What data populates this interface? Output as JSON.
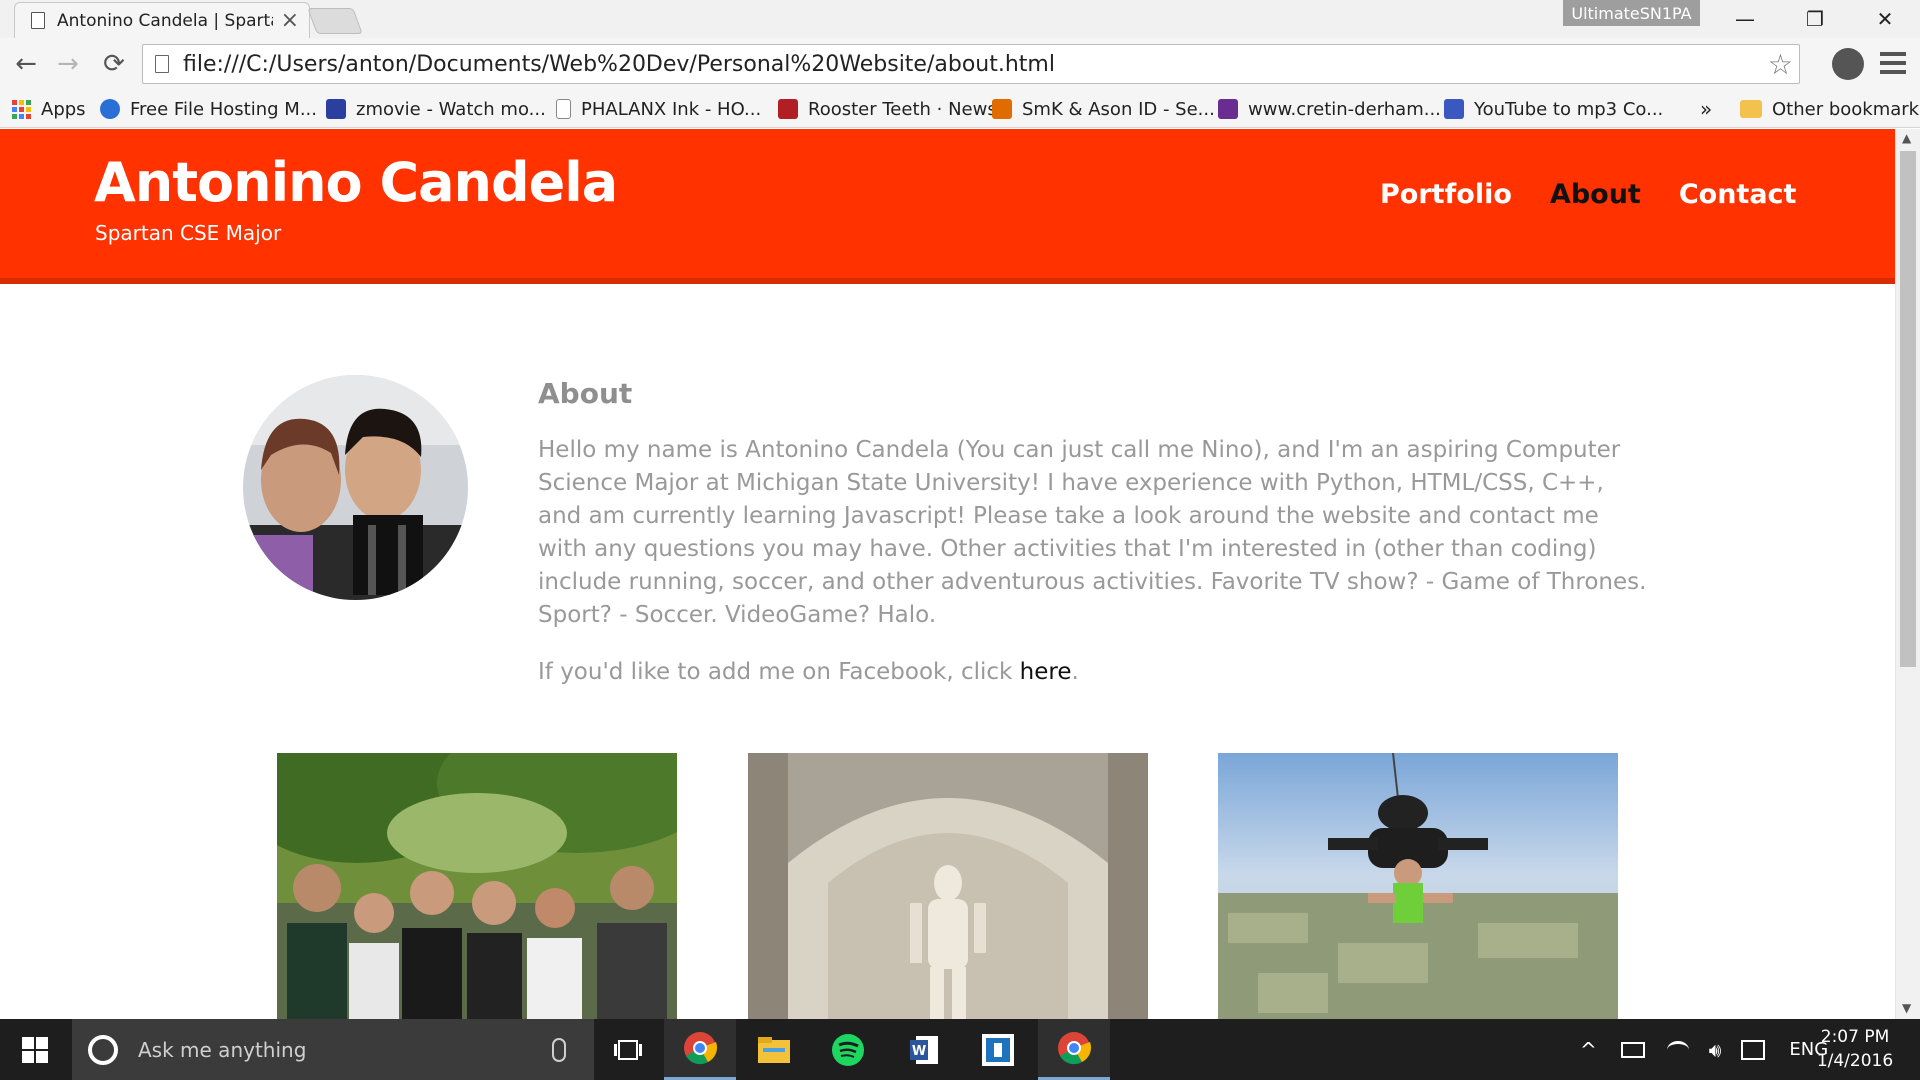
{
  "browser": {
    "tab": {
      "title": "Antonino Candela | Sparta",
      "close": "×"
    },
    "profile": "UltimateSN1PA",
    "window": {
      "minimize": "—",
      "restore": "❐",
      "close": "✕"
    },
    "nav": {
      "back": "←",
      "forward": "→",
      "reload": "⟳"
    },
    "url": "file:///C:/Users/anton/Documents/Web%20Dev/Personal%20Website/about.html",
    "star": "☆"
  },
  "bookmarks": {
    "items": [
      {
        "label": "Apps",
        "icon": "apps-grid-icon"
      },
      {
        "label": "Free File Hosting M...",
        "icon": "cloud-icon",
        "color": "#2a6fd6"
      },
      {
        "label": "zmovie - Watch mo...",
        "icon": "film-icon",
        "color": "#2b3f9e"
      },
      {
        "label": "PHALANX Ink - HO...",
        "icon": "page-icon",
        "color": "#888888"
      },
      {
        "label": "Rooster Teeth · News",
        "icon": "rooster-teeth-icon",
        "color": "#b11f24"
      },
      {
        "label": "SmK & Ason ID - Se...",
        "icon": "smk-icon",
        "color": "#e06c00"
      },
      {
        "label": "www.cretin-derham...",
        "icon": "cretin-icon",
        "color": "#6b2c91"
      },
      {
        "label": "YouTube to mp3 Co...",
        "icon": "yt-mp3-icon",
        "color": "#3a58c0"
      }
    ],
    "overflow": "»",
    "other": "Other bookmarks"
  },
  "site": {
    "title": "Antonino Candela",
    "subtitle": "Spartan CSE Major",
    "nav": [
      {
        "label": "Portfolio",
        "active": false
      },
      {
        "label": "About",
        "active": true
      },
      {
        "label": "Contact",
        "active": false
      }
    ],
    "colors": {
      "header": "#ff3200",
      "nav_active": "#111111",
      "nav_default": "#ffffff",
      "text": "#999999"
    }
  },
  "about": {
    "heading": "About",
    "paragraph": "Hello my name is Antonino Candela (You can just call me Nino), and I'm an aspiring Computer Science Major at Michigan State University! I have experience with Python, HTML/CSS, C++, and am currently learning Javascript! Please take a look around the website and contact me with any questions you may have. Other activities that I'm interested in (other than coding) include running, soccer, and other adventurous activities. Favorite TV show? - Game of Thrones. Sport? - Soccer. VideoGame? Halo.",
    "facebook_prefix": "If you'd like to add me on Facebook, click ",
    "facebook_link": "here",
    "facebook_suffix": "."
  },
  "taskbar": {
    "search_placeholder": "Ask me anything",
    "apps": [
      "chrome-icon",
      "file-explorer-icon",
      "spotify-icon",
      "word-icon",
      "mobile-app-icon",
      "chrome-icon"
    ],
    "language": "ENG",
    "time": "2:07 PM",
    "date": "1/4/2016",
    "tray_up": "^"
  }
}
